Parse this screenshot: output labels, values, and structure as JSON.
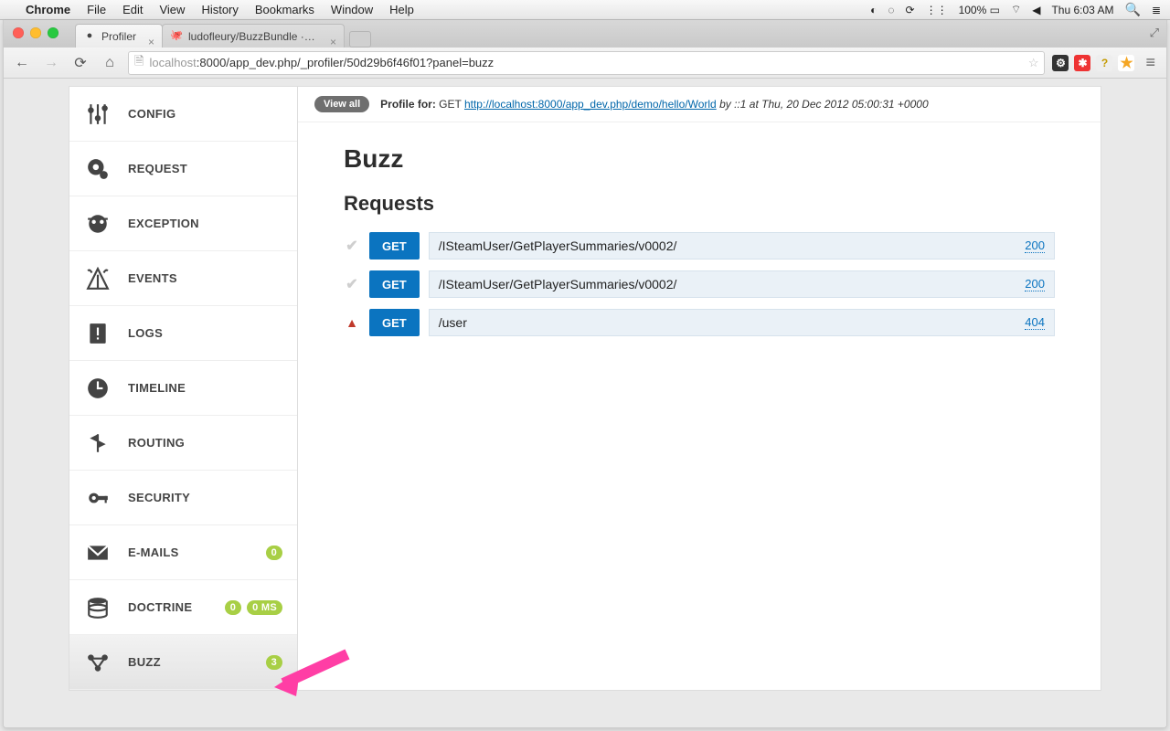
{
  "mac_menu": {
    "app": "Chrome",
    "items": [
      "File",
      "Edit",
      "View",
      "History",
      "Bookmarks",
      "Window",
      "Help"
    ],
    "battery": "100%",
    "clock": "Thu 6:03 AM"
  },
  "browser": {
    "tabs": [
      {
        "title": "Profiler",
        "active": true
      },
      {
        "title": "ludofleury/BuzzBundle · GitHub",
        "active": false
      }
    ],
    "url_host": "localhost",
    "url_path": ":8000/app_dev.php/_profiler/50d29b6f46f01?panel=buzz"
  },
  "profile_bar": {
    "view_all": "View all",
    "label": "Profile for:",
    "method": "GET",
    "url": "http://localhost:8000/app_dev.php/demo/hello/World",
    "by_prefix": "by",
    "by": "::1",
    "at_prefix": "at",
    "at": "Thu, 20 Dec 2012 05:00:31 +0000"
  },
  "sidebar": {
    "items": [
      {
        "label": "Config"
      },
      {
        "label": "Request"
      },
      {
        "label": "Exception"
      },
      {
        "label": "Events"
      },
      {
        "label": "Logs"
      },
      {
        "label": "Timeline"
      },
      {
        "label": "Routing"
      },
      {
        "label": "Security"
      },
      {
        "label": "E-mails",
        "badges": [
          "0"
        ]
      },
      {
        "label": "Doctrine",
        "badges": [
          "0",
          "0 MS"
        ]
      },
      {
        "label": "Buzz",
        "badges": [
          "3"
        ],
        "active": true
      }
    ]
  },
  "panel": {
    "title": "Buzz",
    "section": "Requests",
    "requests": [
      {
        "status": "ok",
        "method": "GET",
        "path": "/ISteamUser/GetPlayerSummaries/v0002/",
        "code": "200"
      },
      {
        "status": "ok",
        "method": "GET",
        "path": "/ISteamUser/GetPlayerSummaries/v0002/",
        "code": "200"
      },
      {
        "status": "error",
        "method": "GET",
        "path": "/user",
        "code": "404"
      }
    ]
  }
}
